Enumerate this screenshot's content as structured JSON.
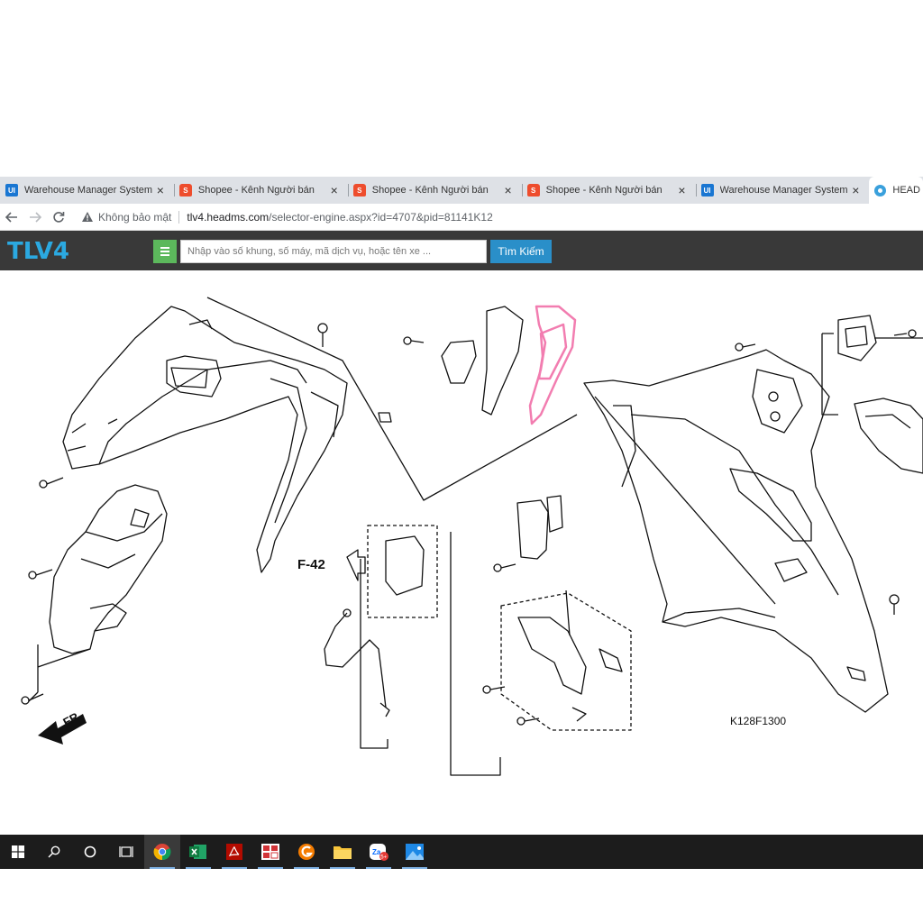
{
  "browser": {
    "tabs": [
      {
        "title": "Warehouse Manager System",
        "icon": "ui-logo-icon"
      },
      {
        "title": "Shopee - Kênh Người bán",
        "icon": "shopee-bag-icon"
      },
      {
        "title": "Shopee - Kênh Người bán",
        "icon": "shopee-bag-icon"
      },
      {
        "title": "Shopee - Kênh Người bán",
        "icon": "shopee-bag-icon"
      },
      {
        "title": "Warehouse Manager System",
        "icon": "ui-logo-icon"
      },
      {
        "title": "HEAD",
        "icon": "head-site-icon"
      }
    ],
    "favicon_ui_text": "UI",
    "favicon_shopee_text": "S",
    "close_glyph": "×",
    "security_label": "Không bảo mật",
    "url_host": "tlv4.headms.com",
    "url_path": "/selector-engine.aspx?id=4707&pid=81141K12"
  },
  "site": {
    "logo": "TLV4",
    "search_placeholder": "Nhập vào số khung, số máy, mã dịch vụ, hoặc tên xe ...",
    "search_button": "Tìm Kiếm",
    "brand_color": "#2ba9e1",
    "header_bg": "#393939",
    "menu_color": "#5cb85c",
    "button_color": "#2a8fc9"
  },
  "diagram": {
    "ref_label": "F-42",
    "front_label": "FR.",
    "code": "K128F1300",
    "highlight_color": "#f27db0"
  },
  "taskbar": {
    "items": [
      "windows-start-icon",
      "search-icon",
      "cortana-icon",
      "task-view-icon",
      "chrome-icon",
      "excel-icon",
      "acrobat-icon",
      "app-grid-icon",
      "orange-app-icon",
      "file-explorer-icon",
      "zalo-icon",
      "photos-icon"
    ],
    "zalo_badge": "5+"
  }
}
